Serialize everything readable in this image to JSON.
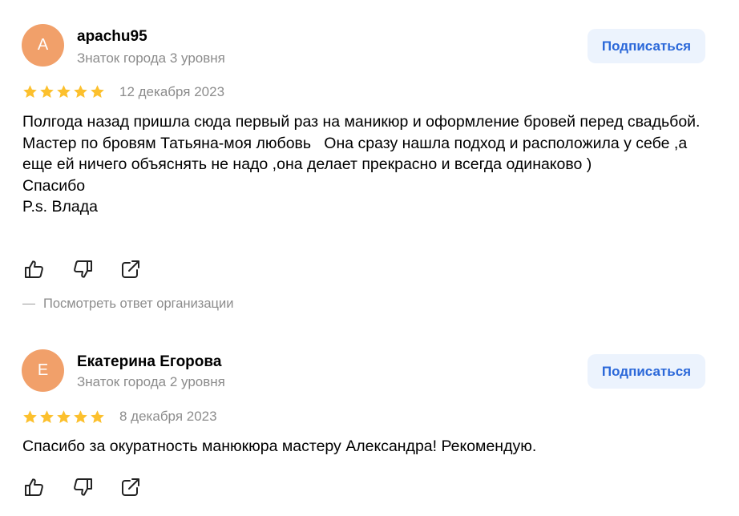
{
  "colors": {
    "avatar_bg": "#f1a06a",
    "star": "#fcc02d",
    "subscribe_bg": "#ecf3fd",
    "subscribe_text": "#2b68d9",
    "muted_text": "#8c8c8c"
  },
  "reviews": [
    {
      "avatar_letter": "A",
      "author": "apachu95",
      "level": "Знаток города 3 уровня",
      "subscribe_label": "Подписаться",
      "rating": 5,
      "date": "12 декабря 2023",
      "text": "Полгода назад пришла сюда первый раз на маникюр и оформление бровей перед свадьбой.\nМастер по бровям Татьяна-моя любовь   Она сразу нашла подход и расположила у себе ,а еще ей ничего объяснять не надо ,она делает прекрасно и всегда одинаково )\nСпасибо\nP.s. Влада",
      "icons": [
        "thumbs-up-icon",
        "thumbs-down-icon",
        "share-icon"
      ],
      "org_reply_link": "Посмотреть ответ организации"
    },
    {
      "avatar_letter": "Е",
      "author": "Екатерина Егорова",
      "level": "Знаток города 2 уровня",
      "subscribe_label": "Подписаться",
      "rating": 5,
      "date": "8 декабря 2023",
      "text": "Спасибо за окуратность манюкюра мастеру Александра! Рекомендую.",
      "icons": [
        "thumbs-up-icon",
        "thumbs-down-icon",
        "share-icon"
      ]
    }
  ]
}
